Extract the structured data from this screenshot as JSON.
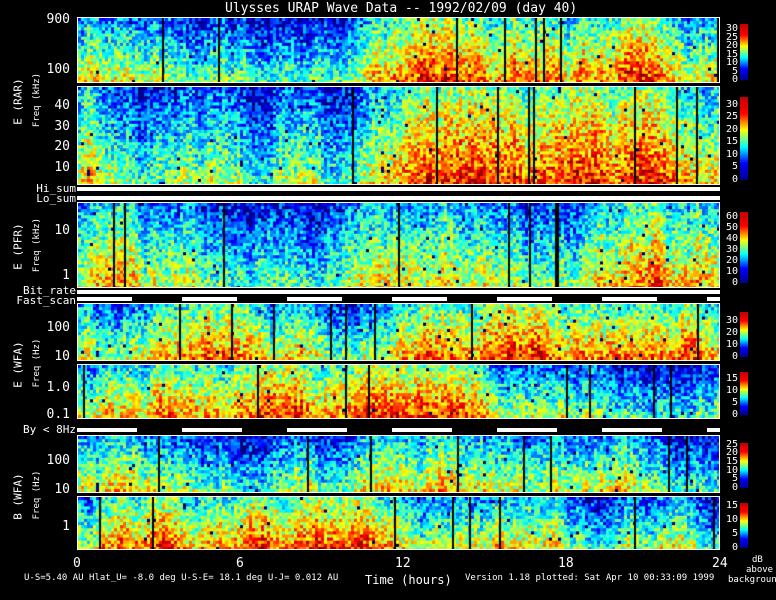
{
  "title": "Ulysses URAP Wave Data -- 1992/02/09  (day 40)",
  "chart_data": {
    "type": "heatmap",
    "title": "Ulysses URAP Wave Data -- 1992/02/09  (day 40)",
    "xlabel": "Time (hours)",
    "xlim": [
      0,
      24
    ],
    "x_ticks": [
      "0",
      "6",
      "12",
      "18",
      "24"
    ],
    "colormap": "jet",
    "colorbar_label": [
      "dB",
      "above",
      "background"
    ],
    "panels": [
      {
        "id": "rar-high",
        "group_label": "E (RAR)",
        "ylabel": "Freq (kHz)",
        "yscale": "log",
        "y_ticks": [
          "900",
          "100"
        ],
        "cbar_ticks": [
          "30",
          "25",
          "20",
          "15",
          "10",
          "5",
          "0"
        ],
        "cbar_range": [
          0,
          33
        ]
      },
      {
        "id": "rar-low",
        "ylabel": "",
        "yscale": "linear",
        "y_ticks": [
          "40",
          "30",
          "20",
          "10"
        ],
        "cbar_ticks": [
          "30",
          "25",
          "20",
          "15",
          "10",
          "5",
          "0"
        ],
        "cbar_range": [
          0,
          33
        ]
      },
      {
        "id": "pfr",
        "group_label": "E (PFR)",
        "ylabel": "Freq (kHz)",
        "yscale": "log",
        "y_ticks": [
          "10",
          "1"
        ],
        "cbar_ticks": [
          "60",
          "50",
          "40",
          "30",
          "20",
          "10",
          "0"
        ],
        "cbar_range": [
          0,
          65
        ]
      },
      {
        "id": "wfa-e-high",
        "group_label": "E (WFA)",
        "ylabel": "Freq (Hz)",
        "yscale": "log",
        "y_ticks": [
          "100",
          "10"
        ],
        "cbar_ticks": [
          "30",
          "20",
          "10",
          "0"
        ],
        "cbar_range": [
          0,
          38
        ]
      },
      {
        "id": "wfa-e-low",
        "yscale": "log",
        "y_ticks": [
          "1.0",
          "0.1"
        ],
        "cbar_ticks": [
          "15",
          "10",
          "5",
          "0"
        ],
        "cbar_range": [
          0,
          18
        ]
      },
      {
        "id": "wfa-b-high",
        "group_label": "B (WFA)",
        "ylabel": "Freq (Hz)",
        "yscale": "log",
        "y_ticks": [
          "100",
          "10"
        ],
        "cbar_ticks": [
          "25",
          "20",
          "15",
          "10",
          "5",
          "0"
        ],
        "cbar_range": [
          0,
          26
        ]
      },
      {
        "id": "wfa-b-low",
        "yscale": "log",
        "y_ticks": [
          "1"
        ],
        "cbar_ticks": [
          "15",
          "10",
          "5",
          "0"
        ],
        "cbar_range": [
          0,
          16
        ]
      }
    ],
    "status_bars": [
      "Hi_sum",
      "Lo_sum",
      "Bit_rate",
      "Fast_scan",
      "By < 8Hz"
    ]
  },
  "footer": {
    "left": "U-S=5.40 AU  Hlat_U= -8.0 deg  U-S-E= 18.1 deg  U-J= 0.012 AU",
    "version": "Version 1.18 plotted: Sat Apr 10 00:33:09 1999"
  }
}
